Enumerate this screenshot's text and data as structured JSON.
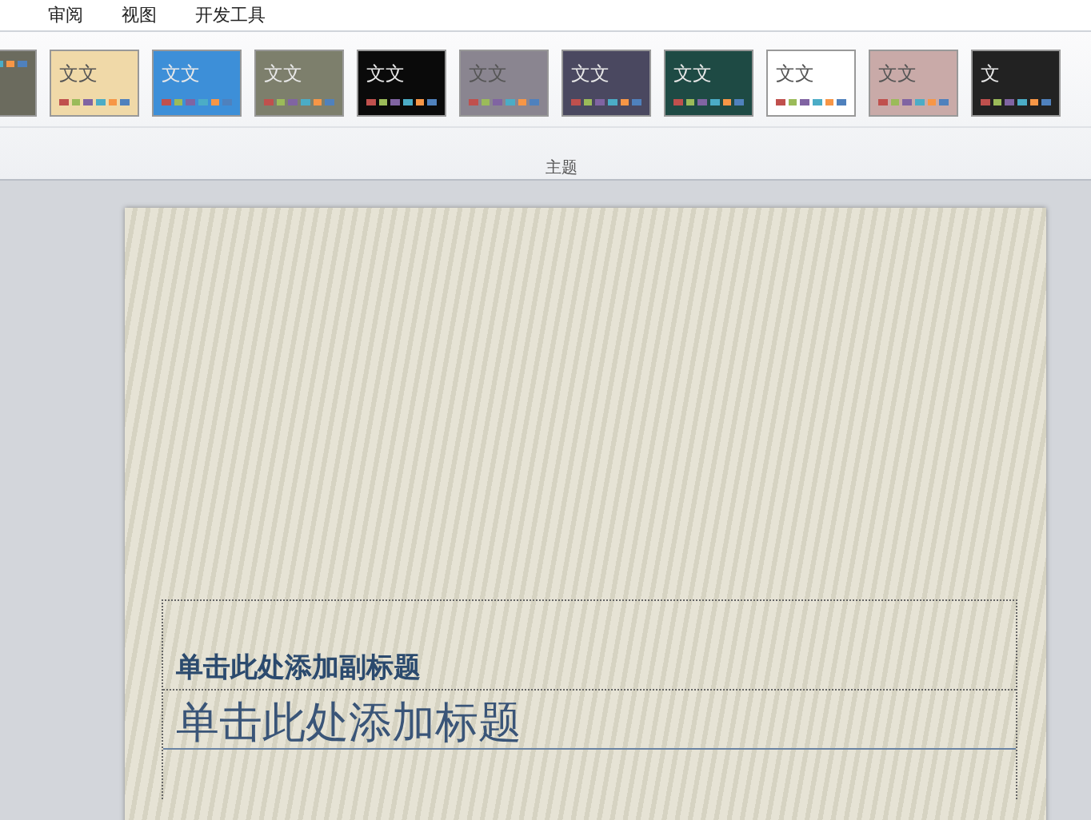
{
  "tabs": [
    {
      "label": "审阅",
      "selected": false
    },
    {
      "label": "视图",
      "selected": false
    },
    {
      "label": "开发工具",
      "selected": false
    }
  ],
  "themes": [
    {
      "color": "#6b6b5e"
    },
    {
      "label": "文文",
      "color": "#f0d9a8"
    },
    {
      "label": "文文",
      "color": "#3d8fd8"
    },
    {
      "label": "文文",
      "color": "#7d7f6c"
    },
    {
      "label": "文文",
      "color": "#0a0a0a"
    },
    {
      "label": "文文",
      "color": "#8a8590"
    },
    {
      "label": "文文",
      "color": "#4a4860"
    },
    {
      "label": "文文",
      "color": "#1e4a44"
    },
    {
      "label": "文文",
      "color": "#ffffff"
    },
    {
      "label": "文文",
      "color": "#c9aaa8"
    },
    {
      "label": "文",
      "color": "#222222"
    }
  ],
  "group_label": "主题",
  "slide": {
    "subtitle_placeholder": "单击此处添加副标题",
    "title_placeholder": "单击此处添加标题"
  }
}
